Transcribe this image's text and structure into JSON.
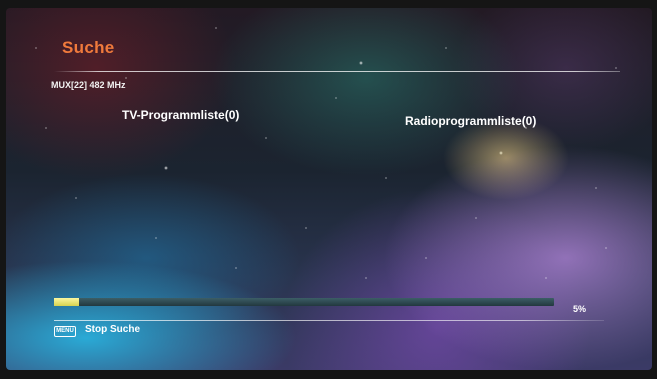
{
  "screen": {
    "title": "Suche",
    "title_color": "#f07a3c",
    "mux_info": "MUX[22] 482 MHz",
    "tv_program_list": "TV-Programmliste(0)",
    "radio_program_list": "Radioprogrammliste(0)"
  },
  "progress": {
    "percent": 5,
    "percent_label": "5%",
    "fill_color": "#e7e37a",
    "track_color": "#2e4a52"
  },
  "footer": {
    "menu_key_label": "MENU",
    "stop_label": "Stop Suche"
  }
}
